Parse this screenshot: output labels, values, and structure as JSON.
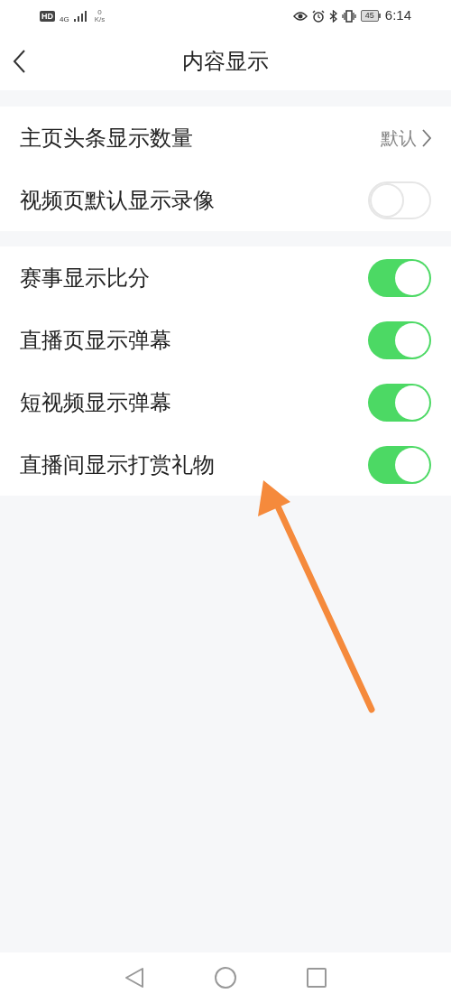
{
  "status_bar": {
    "hd": "HD",
    "network": "4G",
    "speed_value": "0",
    "speed_unit": "K/s",
    "battery": "45",
    "time": "6:14"
  },
  "header": {
    "title": "内容显示"
  },
  "groups": [
    {
      "items": [
        {
          "kind": "link",
          "label": "主页头条显示数量",
          "value": "默认"
        },
        {
          "kind": "toggle",
          "label": "视频页默认显示录像",
          "on": false
        }
      ]
    },
    {
      "items": [
        {
          "kind": "toggle",
          "label": "赛事显示比分",
          "on": true
        },
        {
          "kind": "toggle",
          "label": "直播页显示弹幕",
          "on": true
        },
        {
          "kind": "toggle",
          "label": "短视频显示弹幕",
          "on": true
        },
        {
          "kind": "toggle",
          "label": "直播间显示打赏礼物",
          "on": true
        }
      ]
    }
  ]
}
